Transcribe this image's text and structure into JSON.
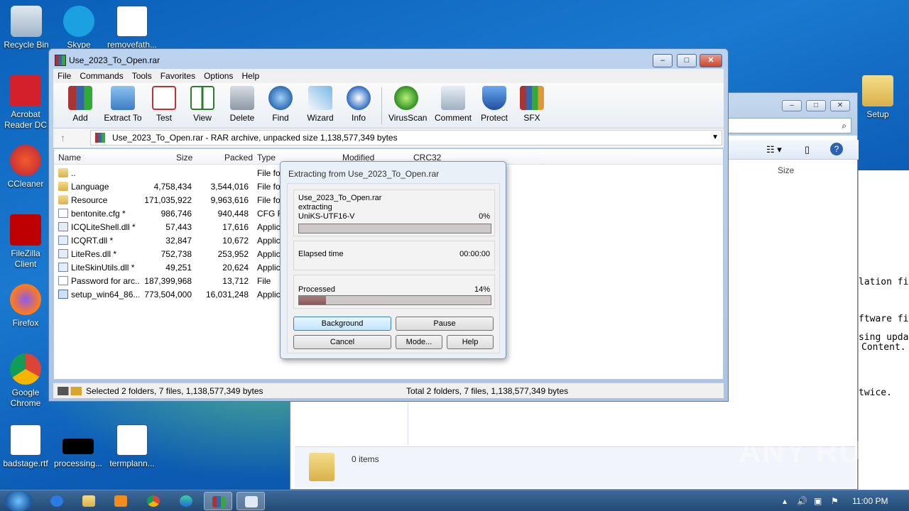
{
  "desktop": {
    "icons": [
      {
        "label": "Recycle Bin",
        "icon": "recycle-bin-icon"
      },
      {
        "label": "Skype",
        "icon": "skype-icon"
      },
      {
        "label": "removefath...",
        "icon": "word-doc-icon"
      },
      {
        "label": "Acrobat Reader DC",
        "icon": "acrobat-icon"
      },
      {
        "label": "CCleaner",
        "icon": "ccleaner-icon"
      },
      {
        "label": "FileZilla Client",
        "icon": "filezilla-icon"
      },
      {
        "label": "Firefox",
        "icon": "firefox-icon"
      },
      {
        "label": "Google Chrome",
        "icon": "chrome-icon"
      },
      {
        "label": "badstage.rtf",
        "icon": "word-doc-icon"
      },
      {
        "label": "processing...",
        "icon": "black-file-icon"
      },
      {
        "label": "termplann...",
        "icon": "word-doc-icon"
      },
      {
        "label": "Setup",
        "icon": "folder-icon"
      }
    ],
    "watermark": "ANY RUN"
  },
  "backwindow": {
    "column": "Size",
    "items": "0 items",
    "side_text": [
      "lation fil",
      "ftware fi",
      "sing upda",
      "Content.",
      "twice."
    ]
  },
  "winrar": {
    "title": "Use_2023_To_Open.rar",
    "menu": [
      "File",
      "Commands",
      "Tools",
      "Favorites",
      "Options",
      "Help"
    ],
    "toolbar": [
      "Add",
      "Extract To",
      "Test",
      "View",
      "Delete",
      "Find",
      "Wizard",
      "Info",
      "VirusScan",
      "Comment",
      "Protect",
      "SFX"
    ],
    "path": "Use_2023_To_Open.rar - RAR archive, unpacked size 1,138,577,349 bytes",
    "columns": [
      "Name",
      "Size",
      "Packed",
      "Type",
      "Modified",
      "CRC32"
    ],
    "rows": [
      {
        "name": "..",
        "size": "",
        "packed": "",
        "type": "File fo",
        "kind": "folder"
      },
      {
        "name": "Language",
        "size": "4,758,434",
        "packed": "3,544,016",
        "type": "File fo",
        "kind": "folder"
      },
      {
        "name": "Resource",
        "size": "171,035,922",
        "packed": "9,963,616",
        "type": "File fo",
        "kind": "folder"
      },
      {
        "name": "bentonite.cfg *",
        "size": "986,746",
        "packed": "940,448",
        "type": "CFG F",
        "kind": "file"
      },
      {
        "name": "ICQLiteShell.dll *",
        "size": "57,443",
        "packed": "17,616",
        "type": "Applic",
        "kind": "dll"
      },
      {
        "name": "ICQRT.dll *",
        "size": "32,847",
        "packed": "10,672",
        "type": "Applic",
        "kind": "dll"
      },
      {
        "name": "LiteRes.dll *",
        "size": "752,738",
        "packed": "253,952",
        "type": "Applic",
        "kind": "dll"
      },
      {
        "name": "LiteSkinUtils.dll *",
        "size": "49,251",
        "packed": "20,624",
        "type": "Applic",
        "kind": "dll"
      },
      {
        "name": "Password for arc...",
        "size": "187,399,968",
        "packed": "13,712",
        "type": "File",
        "kind": "file"
      },
      {
        "name": "setup_win64_86....",
        "size": "773,504,000",
        "packed": "16,031,248",
        "type": "Applic",
        "kind": "exe"
      }
    ],
    "status_left": "Selected 2 folders, 7 files, 1,138,577,349 bytes",
    "status_right": "Total 2 folders, 7 files, 1,138,577,349 bytes"
  },
  "dialog": {
    "title": "Extracting from Use_2023_To_Open.rar",
    "archive": "Use_2023_To_Open.rar",
    "action": "extracting",
    "current_file": "UniKS-UTF16-V",
    "file_percent": "0%",
    "file_progress": 0,
    "elapsed_label": "Elapsed time",
    "elapsed": "00:00:00",
    "processed_label": "Processed",
    "processed_percent": "14%",
    "processed_progress": 0.14,
    "buttons": {
      "background": "Background",
      "pause": "Pause",
      "cancel": "Cancel",
      "mode": "Mode...",
      "help": "Help"
    }
  },
  "taskbar": {
    "clock": "11:00 PM"
  }
}
